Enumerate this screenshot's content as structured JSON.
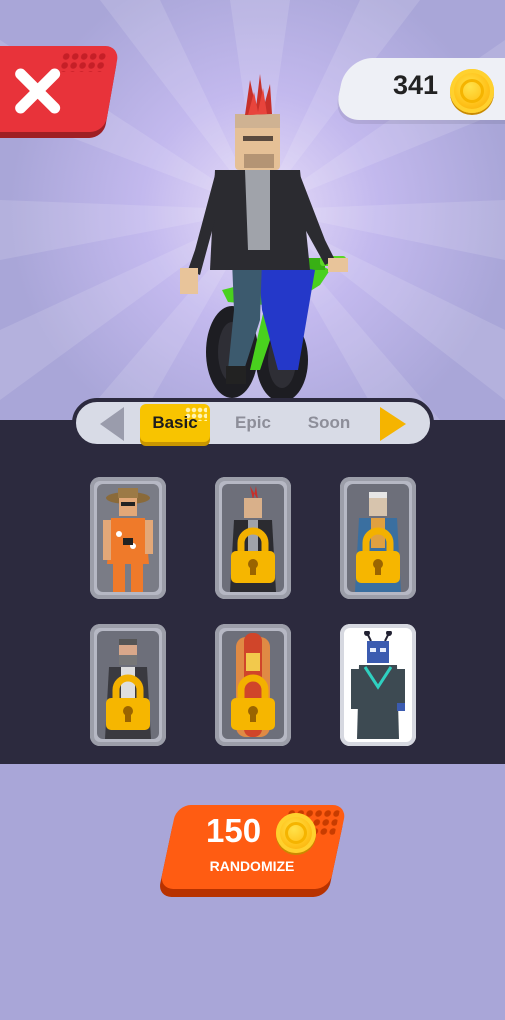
{
  "header": {
    "coins": "341",
    "coin_icon": "coin-icon",
    "close_icon": "close-icon"
  },
  "tabs": [
    {
      "label": "Basic",
      "active": true
    },
    {
      "label": "Epic",
      "active": false
    },
    {
      "label": "Soon",
      "active": false
    }
  ],
  "characters": [
    {
      "name": "tourist",
      "locked": false,
      "selected": false
    },
    {
      "name": "punk",
      "locked": true,
      "selected": false
    },
    {
      "name": "old-man",
      "locked": true,
      "selected": false
    },
    {
      "name": "bearded-man",
      "locked": true,
      "selected": false
    },
    {
      "name": "hot-dog",
      "locked": true,
      "selected": false
    },
    {
      "name": "alien",
      "locked": false,
      "selected": true
    }
  ],
  "randomize": {
    "price": "150",
    "label": "RANDOMIZE"
  },
  "colors": {
    "close_red": "#e8333a",
    "accent_yellow": "#f8c400",
    "randomize_orange": "#ff5c12",
    "panel_dark": "#2c2a3e",
    "background_purple": "#a9a6d8"
  }
}
